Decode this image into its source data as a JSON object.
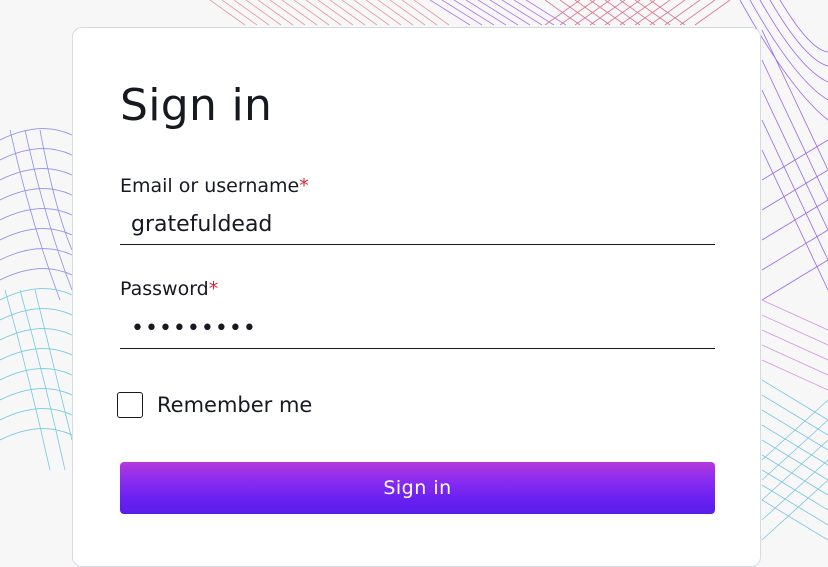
{
  "title": "Sign in",
  "email": {
    "label": "Email or username",
    "required_mark": "*",
    "value": "gratefuldead"
  },
  "password": {
    "label": "Password",
    "required_mark": "*",
    "value": "•••••••••"
  },
  "remember": {
    "label": "Remember me",
    "checked": false
  },
  "submit": {
    "label": "Sign in"
  },
  "colors": {
    "accent_top": "#b53ad9",
    "accent_bottom": "#5b1ee8",
    "required": "#d1283a"
  }
}
